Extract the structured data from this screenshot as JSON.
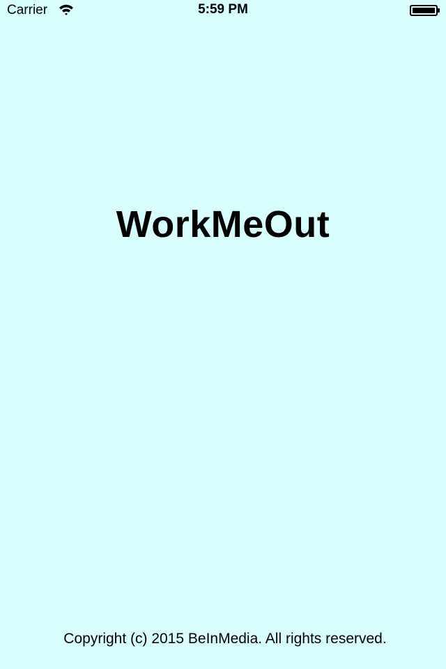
{
  "status_bar": {
    "carrier": "Carrier",
    "time": "5:59 PM",
    "wifi_icon": "wifi-icon",
    "battery_icon": "battery-icon",
    "battery_level": 1.0
  },
  "splash": {
    "title": "WorkMeOut",
    "copyright": "Copyright (c) 2015 BeInMedia. All rights reserved."
  },
  "colors": {
    "background": "#d8fefe",
    "text": "#000000"
  }
}
